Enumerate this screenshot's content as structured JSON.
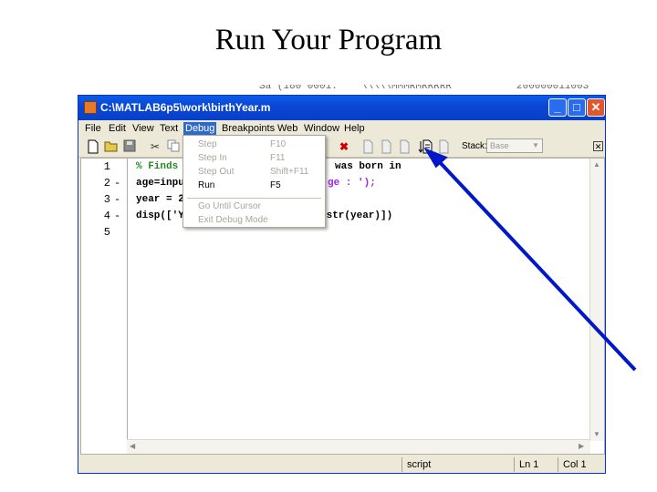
{
  "slide_title": "Run Your Program",
  "background_strip": [
    "",
    "Så (180 0001:",
    "\\\\\\\\\\MMMRMRRRRR",
    "200000011003"
  ],
  "window": {
    "title": "C:\\MATLAB6p5\\work\\birthYear.m",
    "buttons": {
      "minimize": "_",
      "maximize": "□",
      "close": "✕"
    }
  },
  "menubar": [
    "File",
    "Edit",
    "View",
    "Text",
    "Debug",
    "Breakpoints",
    "Web",
    "Window",
    "Help"
  ],
  "active_menu": "Debug",
  "toolbar": {
    "icons": [
      "new-file-icon",
      "open-folder-icon",
      "save-icon",
      "cut-icon",
      "copy-icon",
      "clear-breakpoint-icon",
      "step-icon",
      "step-in-icon",
      "step-out-icon",
      "run-icon",
      "exit-debug-icon"
    ],
    "stack_label": "Stack:",
    "stack_value": "Base"
  },
  "debug_menu": [
    {
      "label": "Step",
      "shortcut": "F10",
      "enabled": false
    },
    {
      "label": "Step In",
      "shortcut": "F11",
      "enabled": false
    },
    {
      "label": "Step Out",
      "shortcut": "Shift+F11",
      "enabled": false
    },
    {
      "label": "Run",
      "shortcut": "F5",
      "enabled": true
    },
    {
      "label": "Go Until Cursor",
      "shortcut": "",
      "enabled": false
    },
    {
      "label": "Exit Debug Mode",
      "shortcut": "",
      "enabled": false
    }
  ],
  "editor": {
    "line_numbers": [
      "1",
      "2",
      "3",
      "4",
      "5"
    ],
    "line_markers": [
      "",
      "-",
      "-",
      "-",
      ""
    ],
    "lines": [
      {
        "left": "% Finds",
        "right": "was born in"
      },
      {
        "left": "age=inpu",
        "right": "ge : ');"
      },
      {
        "left": "year = 2",
        "right": ""
      },
      {
        "left": "disp(['Y",
        "right": "2str(year)])"
      },
      {
        "left": "",
        "right": ""
      }
    ]
  },
  "statusbar": {
    "mode": "script",
    "line": "Ln 1",
    "col": "Col 1"
  },
  "colors": {
    "title_bar": "#0a46d4",
    "menu_highlight": "#316ac5",
    "arrow": "#0018c8",
    "comment": "#228b22",
    "string": "#a020f0"
  }
}
